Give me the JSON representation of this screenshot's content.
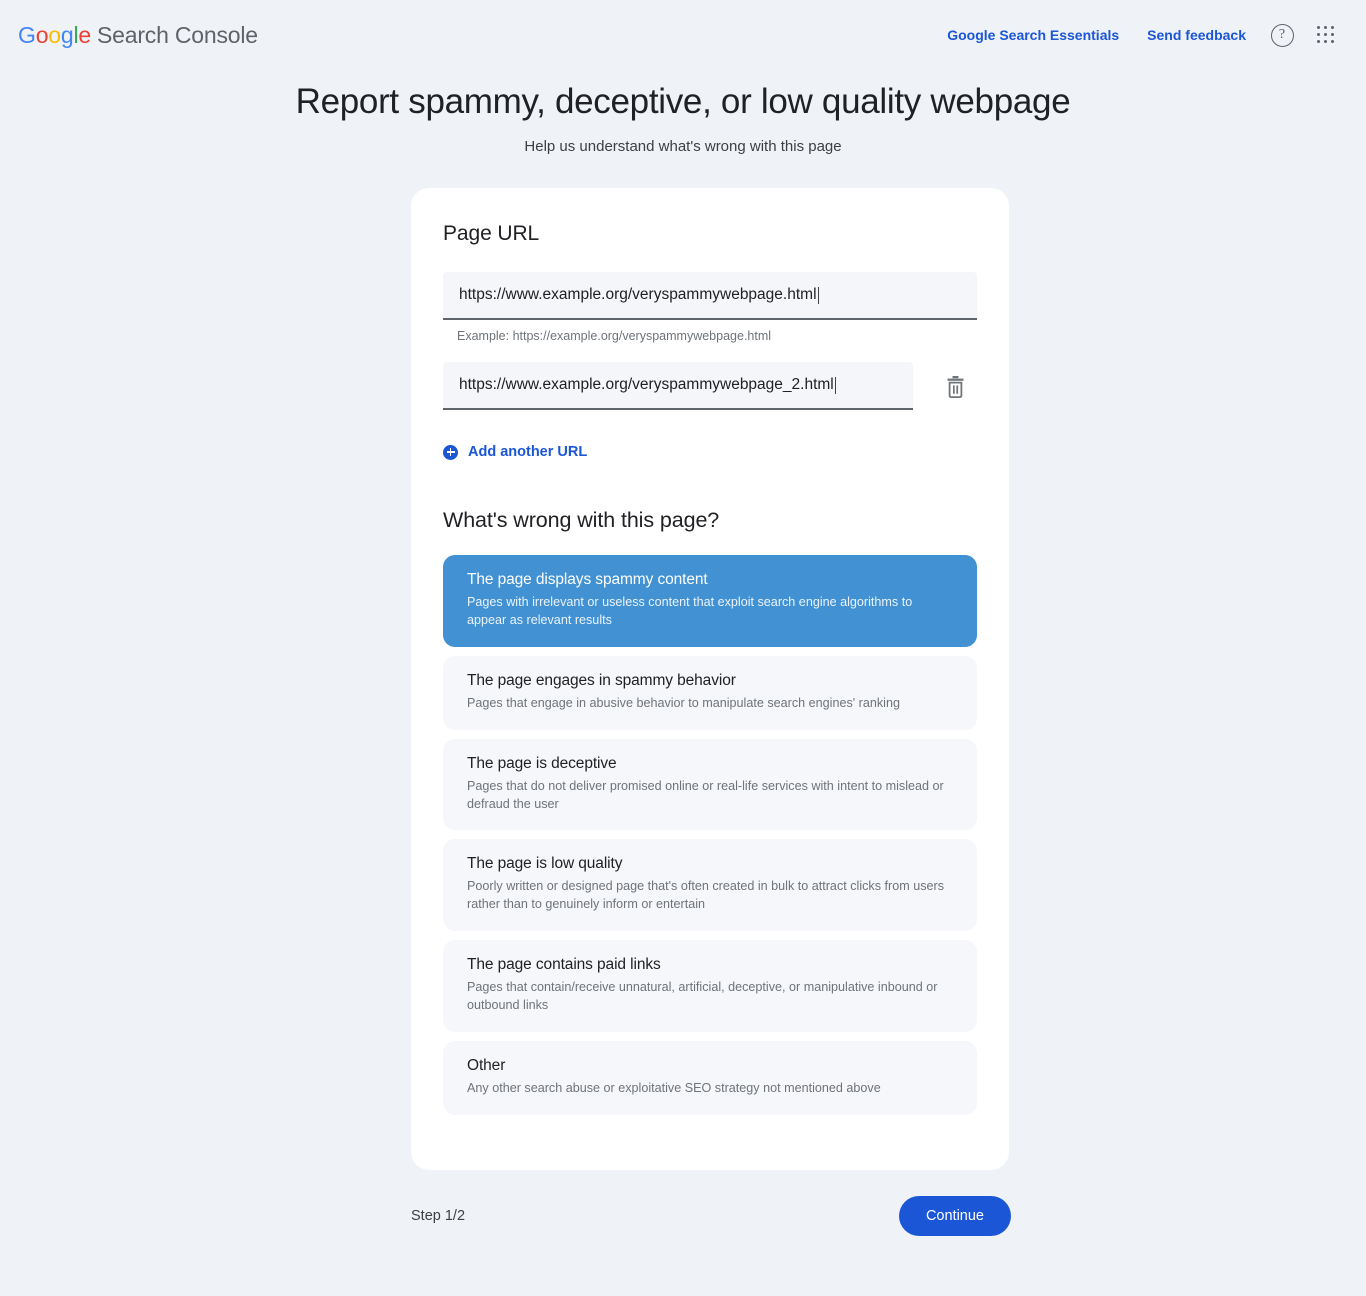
{
  "header": {
    "brand": {
      "g1": "G",
      "o1": "o",
      "o2": "o",
      "g2": "g",
      "l": "l",
      "e": "e",
      "suffix": "Search Console"
    },
    "links": [
      {
        "label": "Google Search Essentials"
      },
      {
        "label": "Send feedback"
      }
    ],
    "help_icon": "help-circle-icon",
    "apps_icon": "apps-grid-icon"
  },
  "title": "Report spammy, deceptive, or low quality webpage",
  "subtitle": "Help us understand what's wrong with this page",
  "url_section": {
    "heading": "Page URL",
    "fields": [
      {
        "value": "https://www.example.org/veryspammywebpage.html",
        "placeholder": "https://example.org/veryspammywebpage.html",
        "hint": "Example: https://example.org/veryspammywebpage.html"
      },
      {
        "value": "https://www.example.org/veryspammywebpage_2.html",
        "placeholder": "https://example.org/veryspammywebpage.html",
        "delete_icon": "trash-icon"
      }
    ],
    "add_another": "Add another URL"
  },
  "question": {
    "heading": "What's wrong with this page?",
    "options": [
      {
        "title": "The page displays spammy content",
        "desc": "Pages with irrelevant or useless content that exploit search engine algorithms to appear as relevant results",
        "selected": true
      },
      {
        "title": "The page engages in spammy behavior",
        "desc": "Pages that engage in abusive behavior to manipulate search engines' ranking",
        "selected": false
      },
      {
        "title": "The page is deceptive",
        "desc": "Pages that do not deliver promised online or real-life services with intent to mislead or defraud the user",
        "selected": false
      },
      {
        "title": "The page is low quality",
        "desc": "Poorly written or designed page that's often created in bulk to attract clicks from users rather than to genuinely inform or entertain",
        "selected": false
      },
      {
        "title": "The page contains paid links",
        "desc": "Pages that contain/receive unnatural, artificial, deceptive, or manipulative inbound or outbound links",
        "selected": false
      },
      {
        "title": "Other",
        "desc": "Any other search abuse or exploitative SEO strategy not mentioned above",
        "selected": false
      }
    ]
  },
  "footer": {
    "step": "Step 1/2",
    "continue_label": "Continue"
  },
  "colors": {
    "page_background": "#eff2f7",
    "accent_blue": "#1a56d6",
    "selected_option": "#4191d3",
    "option_background": "#f5f7fa",
    "input_background": "#f4f6fa"
  }
}
